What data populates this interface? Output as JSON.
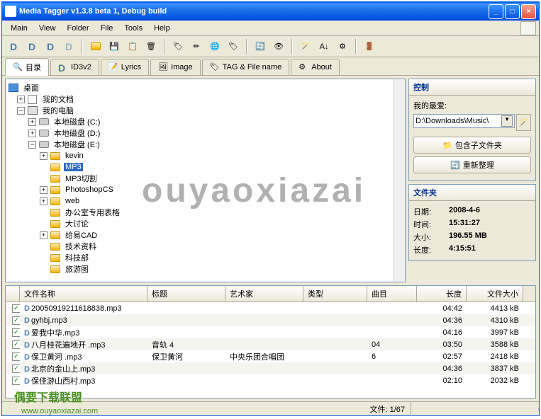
{
  "window": {
    "title": "Media Tagger v1.3.8 beta 1,  Debug build"
  },
  "menu": {
    "main": "Main",
    "view": "View",
    "folder": "Folder",
    "file": "File",
    "tools": "Tools",
    "help": "Help"
  },
  "tabs": {
    "catalog": "目录",
    "id3v2": "ID3v2",
    "lyrics": "Lyrics",
    "image": "Image",
    "tagfile": "TAG & File name",
    "about": "About"
  },
  "tree": {
    "desktop": "桌面",
    "mydocs": "我的文档",
    "mycomputer": "我的电脑",
    "disk_c": "本地磁盘 (C:)",
    "disk_d": "本地磁盘 (D:)",
    "disk_e": "本地磁盘 (E:)",
    "kevin": "kevin",
    "mp3": "MP3",
    "mp3cut": "MP3切割",
    "photoshopcs": "PhotoshopCS",
    "web": "web",
    "office": "办公室专用表格",
    "discuss": "大讨论",
    "cad": "给易CAD",
    "tech": "技术资料",
    "science": "科技部",
    "travel": "旅游图"
  },
  "control_panel": {
    "header": "控制",
    "fav_label": "我的最爱:",
    "fav_value": "D:\\Downloads\\Music\\",
    "btn_subfolder": "包含子文件夹",
    "btn_refresh": "重新整理"
  },
  "folder_panel": {
    "header": "文件夹",
    "date_label": "日期:",
    "date_value": "2008-4-6",
    "time_label": "时间:",
    "time_value": "15:31:27",
    "size_label": "大小:",
    "size_value": "196.55 MB",
    "length_label": "长度:",
    "length_value": "4:15:51"
  },
  "list": {
    "headers": {
      "filename": "文件名称",
      "title": "标题",
      "artist": "艺术家",
      "genre": "类型",
      "track": "曲目",
      "length": "长度",
      "filesize": "文件大小"
    },
    "rows": [
      {
        "checked": true,
        "filename": "20050919211618838.mp3",
        "title": "",
        "artist": "",
        "genre": "",
        "track": "",
        "length": "04:42",
        "size": "4413 kB"
      },
      {
        "checked": true,
        "filename": "gyhbj.mp3",
        "title": "",
        "artist": "",
        "genre": "",
        "track": "",
        "length": "04:36",
        "size": "4310 kB"
      },
      {
        "checked": true,
        "filename": "爱我中华.mp3",
        "title": "",
        "artist": "",
        "genre": "",
        "track": "",
        "length": "04:16",
        "size": "3997 kB"
      },
      {
        "checked": true,
        "filename": "八月桂花遍地开 .mp3",
        "title": "音轨 4",
        "artist": "",
        "genre": "",
        "track": "04",
        "length": "03:50",
        "size": "3588 kB"
      },
      {
        "checked": true,
        "filename": "保卫黄河 .mp3",
        "title": "保卫黄河",
        "artist": "中央乐团合唱团",
        "genre": "",
        "track": "6",
        "length": "02:57",
        "size": "2418 kB"
      },
      {
        "checked": true,
        "filename": "北京的金山上.mp3",
        "title": "",
        "artist": "",
        "genre": "",
        "track": "",
        "length": "04:36",
        "size": "3837 kB"
      },
      {
        "checked": true,
        "filename": "保佳游山西村.mp3",
        "title": "",
        "artist": "",
        "genre": "",
        "track": "",
        "length": "02:10",
        "size": "2032 kB"
      }
    ]
  },
  "statusbar": {
    "files": "文件: 1/67"
  },
  "watermark": {
    "text": "ouyaoxiazai",
    "logo": "偶要下载联盟",
    "url": "www.ouyaoxiazai.com"
  }
}
